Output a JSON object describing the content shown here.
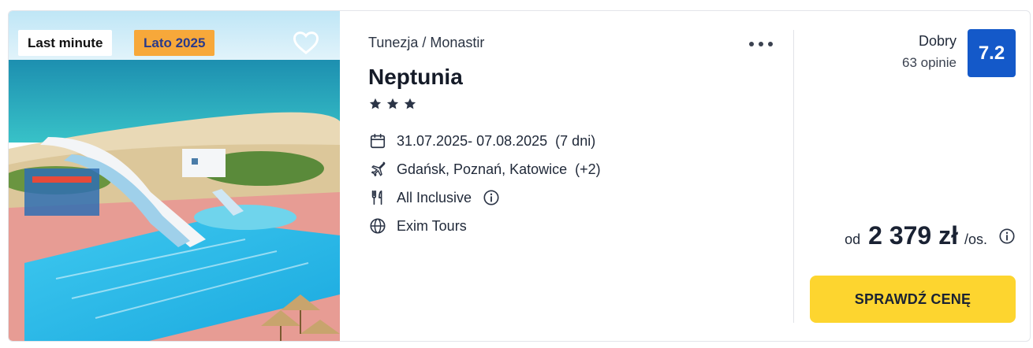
{
  "badges": {
    "last_minute": "Last minute",
    "season": "Lato 2025"
  },
  "hotel": {
    "breadcrumb": "Tunezja / Monastir",
    "name": "Neptunia",
    "stars": 3
  },
  "details": {
    "dates": "31.07.2025- 07.08.2025",
    "duration": "(7 dni)",
    "airports": "Gdańsk, Poznań, Katowice",
    "airports_extra": "(+2)",
    "board": "All Inclusive",
    "operator": "Exim Tours"
  },
  "rating": {
    "label": "Dobry",
    "reviews": "63 opinie",
    "score": "7.2"
  },
  "price": {
    "prefix": "od",
    "amount": "2 379 zł",
    "suffix": "/os."
  },
  "cta_label": "SPRAWDŹ CENĘ",
  "icons": {
    "favorite": "heart-icon",
    "more": "more-dots-icon",
    "star": "star-icon",
    "dates": "calendar-icon",
    "airports": "plane-icon",
    "board": "cutlery-icon",
    "board_info": "info-icon",
    "operator": "globe-icon",
    "price_info": "info-icon"
  },
  "colors": {
    "score_bg": "#1459c9",
    "cta_bg": "#fdd52f",
    "season_badge_bg": "#f7a83a",
    "season_badge_text": "#2a3a8a"
  }
}
